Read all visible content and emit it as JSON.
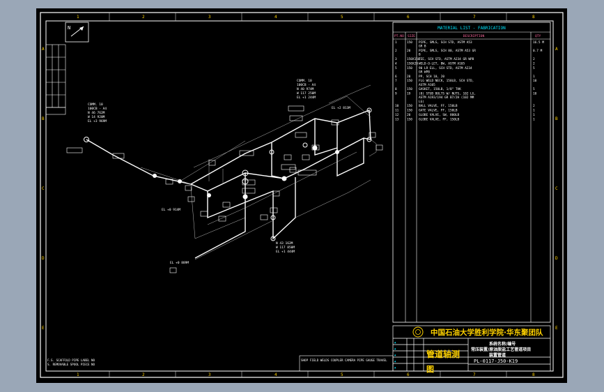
{
  "drawing": {
    "top_ruler": [
      "1",
      "2",
      "3",
      "4",
      "5",
      "6",
      "7",
      "8"
    ],
    "bottom_ruler": [
      "1",
      "2",
      "3",
      "4",
      "5",
      "6",
      "7",
      "8"
    ],
    "left_ruler": [
      "A",
      "B",
      "C",
      "D",
      "E"
    ],
    "right_ruler": [
      "A",
      "B",
      "C",
      "D",
      "E"
    ],
    "north_label": "N"
  },
  "material_list": {
    "title": "MATERIAL LIST - FABRICATION",
    "headers": {
      "item": "PT.NO",
      "size": "SIZE",
      "desc": "DESCRIPTION",
      "qty": "QTY"
    },
    "rows": [
      {
        "item": "1",
        "size": "150",
        "desc": [
          "PIPE, SMLS, SCH STD, ASTM A53",
          "GR B"
        ],
        "qty": "16.5 M"
      },
      {
        "item": "2",
        "size": "20",
        "desc": [
          "PIPE, SMLS, SCH 80, ASTM A53 GR",
          "B"
        ],
        "qty": "0.7 M"
      },
      {
        "item": "3",
        "size": "150X150",
        "desc": [
          "TEE, SCH STD, ASTM A234 GR WPB"
        ],
        "qty": "2"
      },
      {
        "item": "4",
        "size": "150X20",
        "desc": [
          "WELD-O-LET, BW, ASTM A105"
        ],
        "qty": "2"
      },
      {
        "item": "5",
        "size": "150",
        "desc": [
          "90 LR ELL, SCH STD, ASTM A234",
          "GR WPB"
        ],
        "qty": "5"
      },
      {
        "item": "6",
        "size": "20",
        "desc": [
          "PP, SCH 10, 20"
        ],
        "qty": "1"
      },
      {
        "item": "7",
        "size": "150",
        "desc": [
          "FLG WELD NECK, 150LB, SCH STD,",
          "ASTM A105"
        ],
        "qty": "10"
      },
      {
        "item": "8",
        "size": "150",
        "desc": [
          "GASKET, 150LB, 1/8\" THK"
        ],
        "qty": "5"
      },
      {
        "item": "9",
        "size": "19",
        "desc": [
          "(8) STUD BOLTS W/ NUTS, 102 LG,",
          "ASTM A193/194 GR B7/2H (102 MM",
          "LG)"
        ],
        "qty": "10"
      },
      {
        "item": "10",
        "size": "150",
        "desc": [
          "BALL VALVE, FF, 150LB"
        ],
        "qty": "2"
      },
      {
        "item": "11",
        "size": "150",
        "desc": [
          "GATE VALVE, FF, 150LB"
        ],
        "qty": "1"
      },
      {
        "item": "12",
        "size": "20",
        "desc": [
          "GLOBE VALVE, SW, 800LB"
        ],
        "qty": "1"
      },
      {
        "item": "13",
        "size": "150",
        "desc": [
          "GLOBE VALVE, FF, 150LB"
        ],
        "qty": "1"
      }
    ]
  },
  "title_block": {
    "university": "中国石油大学胜利学院·华东聚团队",
    "drawing_title": "管道轴测",
    "project_line1": "系统名称/编号",
    "project_line2": "常压装置/原油脱盐工艺管道项目",
    "project_line3": "装置管道",
    "drawing_number": "PL-0117-J50-K19",
    "bottom_glyph": "图"
  },
  "notes": {
    "note1": "F.S. SCAFFOLD PIPE LABEL NO",
    "note2": "S. REMOVABLE SPOOL PIECE NO",
    "bottom_strip": "SHOP FIELD WELDS  COUPLER CAMERA  PIPE  GAUGE  TRAVEL"
  },
  "annotations": {
    "c1": [
      "COMM. 10",
      "100CB - A4",
      "N 46 762M",
      "W 14 920M",
      "EL +3 969M"
    ],
    "c2": [
      "COMM. 10",
      "100CB - A4",
      "N 40 974M",
      "W 117 250M",
      "EL +1 244M"
    ],
    "c3": [
      "N 43 162M",
      "W 117 850M",
      "EL +1 444M"
    ],
    "c4": [
      "EL +0 914M"
    ],
    "c5": [
      "EL +0 889M"
    ],
    "c6": [
      "EL +2 813M"
    ]
  }
}
